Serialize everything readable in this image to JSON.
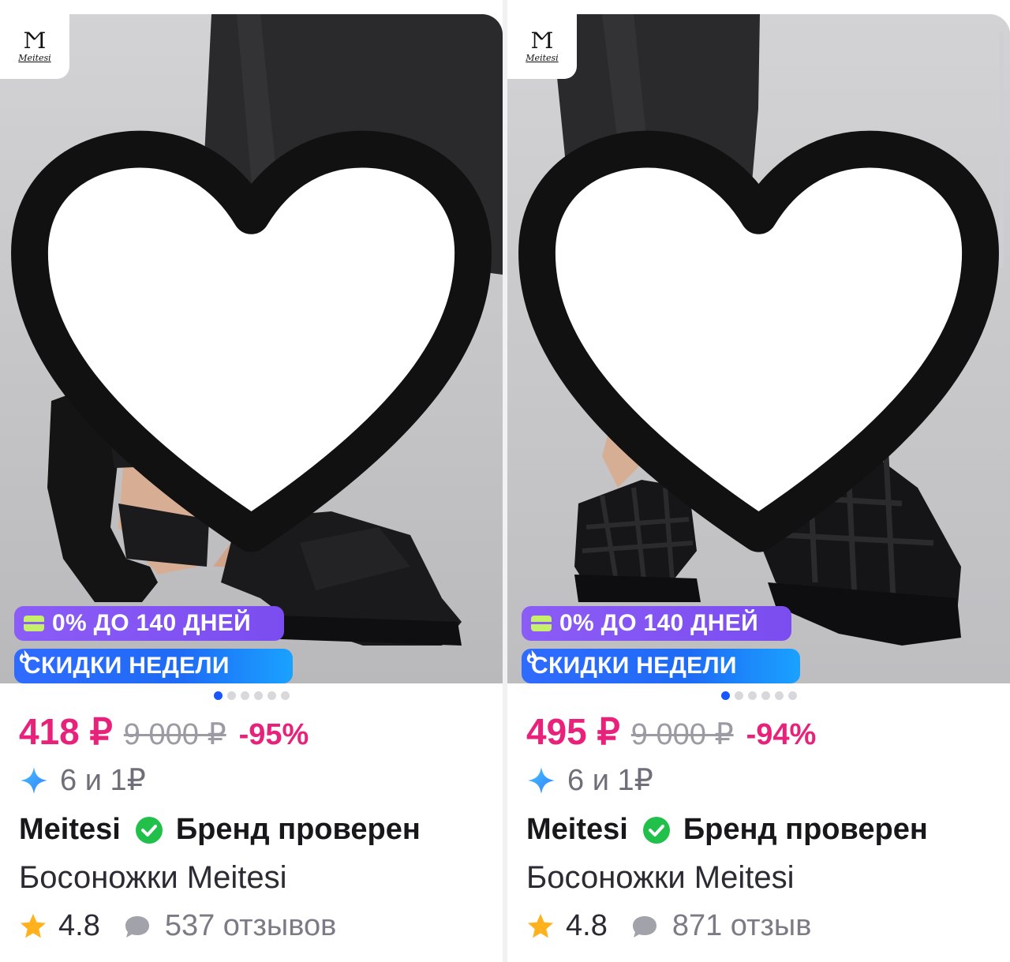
{
  "products": [
    {
      "brand_logo_text": "Meitesi",
      "promo_installment": "0% ДО 140 ДНЕЙ",
      "promo_week": "СКИДКИ НЕДЕЛИ",
      "price": "418 ₽",
      "old_price": "9 000 ₽",
      "discount": "-95%",
      "bonus": "6 и 1₽",
      "brand": "Meitesi",
      "brand_verified": "Бренд проверен",
      "title": "Босоножки Meitesi",
      "rating": "4.8",
      "reviews": "537 отзывов"
    },
    {
      "brand_logo_text": "Meitesi",
      "promo_installment": "0% ДО 140 ДНЕЙ",
      "promo_week": "СКИДКИ НЕДЕЛИ",
      "price": "495 ₽",
      "old_price": "9 000 ₽",
      "discount": "-94%",
      "bonus": "6 и 1₽",
      "brand": "Meitesi",
      "brand_verified": "Бренд проверен",
      "title": "Босоножки Meitesi",
      "rating": "4.8",
      "reviews": "871 отзыв"
    }
  ],
  "carousel": {
    "count": 6,
    "active": 1
  },
  "colors": {
    "price": "#e8227a",
    "installment_badge": "#8b5cf6",
    "week_badge": "#1e6bf5",
    "verified": "#21c04a",
    "rating_star": "#ffb21e",
    "dot_active": "#1a56ff"
  },
  "icons": [
    "heart-icon",
    "card-icon",
    "flame-icon",
    "sparkle-icon",
    "verified-check-icon",
    "star-icon",
    "chat-bubble-icon"
  ]
}
